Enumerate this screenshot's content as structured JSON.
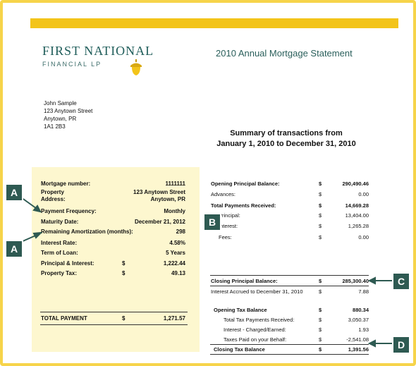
{
  "logo": {
    "name": "FIRST NATIONAL",
    "sub": "FINANCIAL LP"
  },
  "statement_title": "2010 Annual Mortgage Statement",
  "address": [
    "John Sample",
    "123 Anytown Street",
    "Anytown, PR",
    "1A1 2B3"
  ],
  "summary_title": [
    "Summary of transactions from",
    "January 1, 2010 to December 31, 2010"
  ],
  "left_panel": {
    "mortgage_number_label": "Mortgage number:",
    "mortgage_number": "1111111",
    "property_address_label": [
      "Property",
      "Address:"
    ],
    "property_address": [
      "123 Anytown Street",
      "Anytown, PR"
    ],
    "payment_frequency_label": "Payment Frequency:",
    "payment_frequency": "Monthly",
    "maturity_date_label": "Maturity Date:",
    "maturity_date": "December 21, 2012",
    "remaining_amortization_label": "Remaining Amortization (months):",
    "remaining_amortization": "298",
    "interest_rate_label": "Interest Rate:",
    "interest_rate": "4.58%",
    "term_label": "Term of Loan:",
    "term": "5 Years",
    "pi_label": "Principal & Interest:",
    "pi_currency": "$",
    "pi": "1,222.44",
    "property_tax_label": "Property Tax:",
    "property_tax_currency": "$",
    "property_tax": "49.13",
    "total_label": "TOTAL PAYMENT",
    "total_currency": "$",
    "total": "1,271.57"
  },
  "right_panel": {
    "opening_balance_label": "Opening Principal Balance:",
    "opening_balance_cur": "$",
    "opening_balance": "290,490.46",
    "advances_label": "Advances:",
    "advances_cur": "$",
    "advances": "0.00",
    "total_payments_label": "Total Payments Received:",
    "total_payments_cur": "$",
    "total_payments": "14,669.28",
    "principal_label": "Principal:",
    "principal_cur": "$",
    "principal": "13,404.00",
    "interest_label": "Interest:",
    "interest_cur": "$",
    "interest": "1,265.28",
    "fees_label": "Fees:",
    "fees_cur": "$",
    "fees": "0.00",
    "closing_balance_label": "Closing Principal Balance:",
    "closing_balance_cur": "$",
    "closing_balance": "285,300.40",
    "interest_accrued_label": "Interest Accrued to December 31, 2010",
    "interest_accrued_cur": "$",
    "interest_accrued": "7.88",
    "opening_tax_label": "Opening Tax Balance",
    "opening_tax_cur": "$",
    "opening_tax": "880.34",
    "tax_payments_label": "Total Tax Payments Received:",
    "tax_payments_cur": "$",
    "tax_payments": "3,050.37",
    "tax_interest_label": "Interest - Charged/Earned:",
    "tax_interest_cur": "$",
    "tax_interest": "1.93",
    "taxes_paid_label": "Taxes Paid on your Behalf:",
    "taxes_paid_cur": "$",
    "taxes_paid": "-2,541.08",
    "closing_tax_label": "Closing Tax Balance",
    "closing_tax_cur": "$",
    "closing_tax": "1,391.56"
  },
  "markers": [
    "A",
    "A",
    "B",
    "C",
    "D"
  ],
  "colors": {
    "accent": "#f3c41a",
    "brand": "#1f5d5a",
    "panel": "#fdf7cf",
    "marker": "#2e5a52"
  }
}
